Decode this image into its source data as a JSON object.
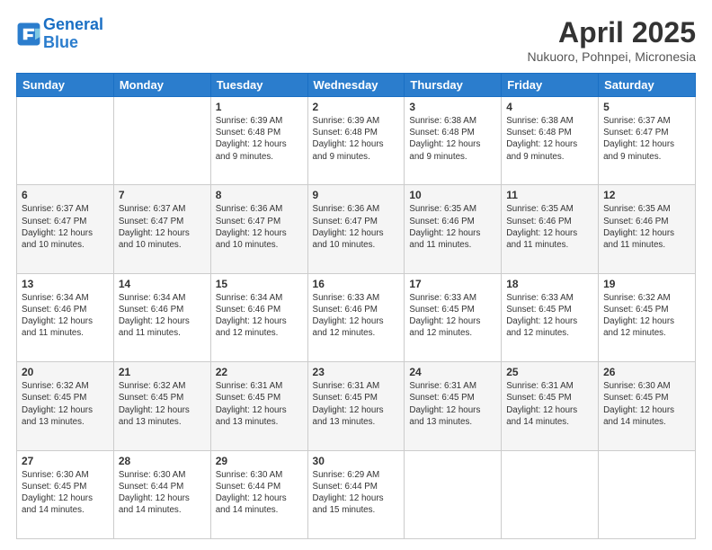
{
  "header": {
    "logo_line1": "General",
    "logo_line2": "Blue",
    "month_year": "April 2025",
    "location": "Nukuoro, Pohnpei, Micronesia"
  },
  "weekdays": [
    "Sunday",
    "Monday",
    "Tuesday",
    "Wednesday",
    "Thursday",
    "Friday",
    "Saturday"
  ],
  "rows": [
    [
      {
        "day": "",
        "info": ""
      },
      {
        "day": "",
        "info": ""
      },
      {
        "day": "1",
        "info": "Sunrise: 6:39 AM\nSunset: 6:48 PM\nDaylight: 12 hours\nand 9 minutes."
      },
      {
        "day": "2",
        "info": "Sunrise: 6:39 AM\nSunset: 6:48 PM\nDaylight: 12 hours\nand 9 minutes."
      },
      {
        "day": "3",
        "info": "Sunrise: 6:38 AM\nSunset: 6:48 PM\nDaylight: 12 hours\nand 9 minutes."
      },
      {
        "day": "4",
        "info": "Sunrise: 6:38 AM\nSunset: 6:48 PM\nDaylight: 12 hours\nand 9 minutes."
      },
      {
        "day": "5",
        "info": "Sunrise: 6:37 AM\nSunset: 6:47 PM\nDaylight: 12 hours\nand 9 minutes."
      }
    ],
    [
      {
        "day": "6",
        "info": "Sunrise: 6:37 AM\nSunset: 6:47 PM\nDaylight: 12 hours\nand 10 minutes."
      },
      {
        "day": "7",
        "info": "Sunrise: 6:37 AM\nSunset: 6:47 PM\nDaylight: 12 hours\nand 10 minutes."
      },
      {
        "day": "8",
        "info": "Sunrise: 6:36 AM\nSunset: 6:47 PM\nDaylight: 12 hours\nand 10 minutes."
      },
      {
        "day": "9",
        "info": "Sunrise: 6:36 AM\nSunset: 6:47 PM\nDaylight: 12 hours\nand 10 minutes."
      },
      {
        "day": "10",
        "info": "Sunrise: 6:35 AM\nSunset: 6:46 PM\nDaylight: 12 hours\nand 11 minutes."
      },
      {
        "day": "11",
        "info": "Sunrise: 6:35 AM\nSunset: 6:46 PM\nDaylight: 12 hours\nand 11 minutes."
      },
      {
        "day": "12",
        "info": "Sunrise: 6:35 AM\nSunset: 6:46 PM\nDaylight: 12 hours\nand 11 minutes."
      }
    ],
    [
      {
        "day": "13",
        "info": "Sunrise: 6:34 AM\nSunset: 6:46 PM\nDaylight: 12 hours\nand 11 minutes."
      },
      {
        "day": "14",
        "info": "Sunrise: 6:34 AM\nSunset: 6:46 PM\nDaylight: 12 hours\nand 11 minutes."
      },
      {
        "day": "15",
        "info": "Sunrise: 6:34 AM\nSunset: 6:46 PM\nDaylight: 12 hours\nand 12 minutes."
      },
      {
        "day": "16",
        "info": "Sunrise: 6:33 AM\nSunset: 6:46 PM\nDaylight: 12 hours\nand 12 minutes."
      },
      {
        "day": "17",
        "info": "Sunrise: 6:33 AM\nSunset: 6:45 PM\nDaylight: 12 hours\nand 12 minutes."
      },
      {
        "day": "18",
        "info": "Sunrise: 6:33 AM\nSunset: 6:45 PM\nDaylight: 12 hours\nand 12 minutes."
      },
      {
        "day": "19",
        "info": "Sunrise: 6:32 AM\nSunset: 6:45 PM\nDaylight: 12 hours\nand 12 minutes."
      }
    ],
    [
      {
        "day": "20",
        "info": "Sunrise: 6:32 AM\nSunset: 6:45 PM\nDaylight: 12 hours\nand 13 minutes."
      },
      {
        "day": "21",
        "info": "Sunrise: 6:32 AM\nSunset: 6:45 PM\nDaylight: 12 hours\nand 13 minutes."
      },
      {
        "day": "22",
        "info": "Sunrise: 6:31 AM\nSunset: 6:45 PM\nDaylight: 12 hours\nand 13 minutes."
      },
      {
        "day": "23",
        "info": "Sunrise: 6:31 AM\nSunset: 6:45 PM\nDaylight: 12 hours\nand 13 minutes."
      },
      {
        "day": "24",
        "info": "Sunrise: 6:31 AM\nSunset: 6:45 PM\nDaylight: 12 hours\nand 13 minutes."
      },
      {
        "day": "25",
        "info": "Sunrise: 6:31 AM\nSunset: 6:45 PM\nDaylight: 12 hours\nand 14 minutes."
      },
      {
        "day": "26",
        "info": "Sunrise: 6:30 AM\nSunset: 6:45 PM\nDaylight: 12 hours\nand 14 minutes."
      }
    ],
    [
      {
        "day": "27",
        "info": "Sunrise: 6:30 AM\nSunset: 6:45 PM\nDaylight: 12 hours\nand 14 minutes."
      },
      {
        "day": "28",
        "info": "Sunrise: 6:30 AM\nSunset: 6:44 PM\nDaylight: 12 hours\nand 14 minutes."
      },
      {
        "day": "29",
        "info": "Sunrise: 6:30 AM\nSunset: 6:44 PM\nDaylight: 12 hours\nand 14 minutes."
      },
      {
        "day": "30",
        "info": "Sunrise: 6:29 AM\nSunset: 6:44 PM\nDaylight: 12 hours\nand 15 minutes."
      },
      {
        "day": "",
        "info": ""
      },
      {
        "day": "",
        "info": ""
      },
      {
        "day": "",
        "info": ""
      }
    ]
  ]
}
